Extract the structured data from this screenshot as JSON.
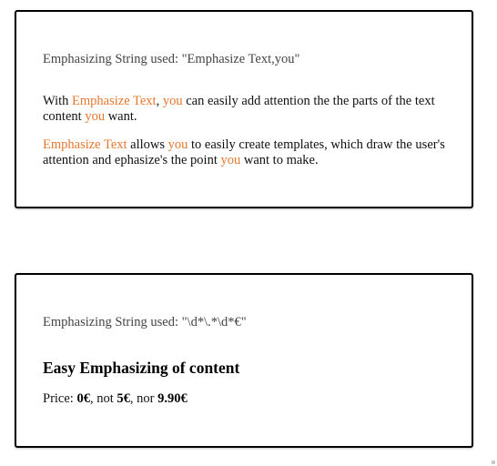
{
  "card1": {
    "caption": "Emphasizing String used: \"Emphasize Text,you\"",
    "paragraph1": [
      {
        "text": "With ",
        "emph": false
      },
      {
        "text": "Emphasize Text",
        "emph": true
      },
      {
        "text": ", ",
        "emph": false
      },
      {
        "text": "you",
        "emph": true
      },
      {
        "text": " can easily add attention the the parts of the text content ",
        "emph": false
      },
      {
        "text": "you",
        "emph": true
      },
      {
        "text": " want.",
        "emph": false
      }
    ],
    "paragraph2": [
      {
        "text": "Emphasize Text",
        "emph": true
      },
      {
        "text": " allows ",
        "emph": false
      },
      {
        "text": "you",
        "emph": true
      },
      {
        "text": " to easily create templates, which draw the user's attention and ephasize's the point ",
        "emph": false
      },
      {
        "text": "you",
        "emph": true
      },
      {
        "text": " want to make.",
        "emph": false
      }
    ]
  },
  "card2": {
    "caption": "Emphasizing String used: \"\\d*\\.*\\d*€\"",
    "heading": "Easy Emphasizing of content",
    "price_parts": [
      {
        "text": "Price: ",
        "bold": false
      },
      {
        "text": "0€",
        "bold": true
      },
      {
        "text": ", not ",
        "bold": false
      },
      {
        "text": "5€",
        "bold": true
      },
      {
        "text": ", nor ",
        "bold": false
      },
      {
        "text": "9.90€",
        "bold": true
      }
    ]
  },
  "colors": {
    "emphasis": "#e8772e",
    "border": "#000000"
  }
}
